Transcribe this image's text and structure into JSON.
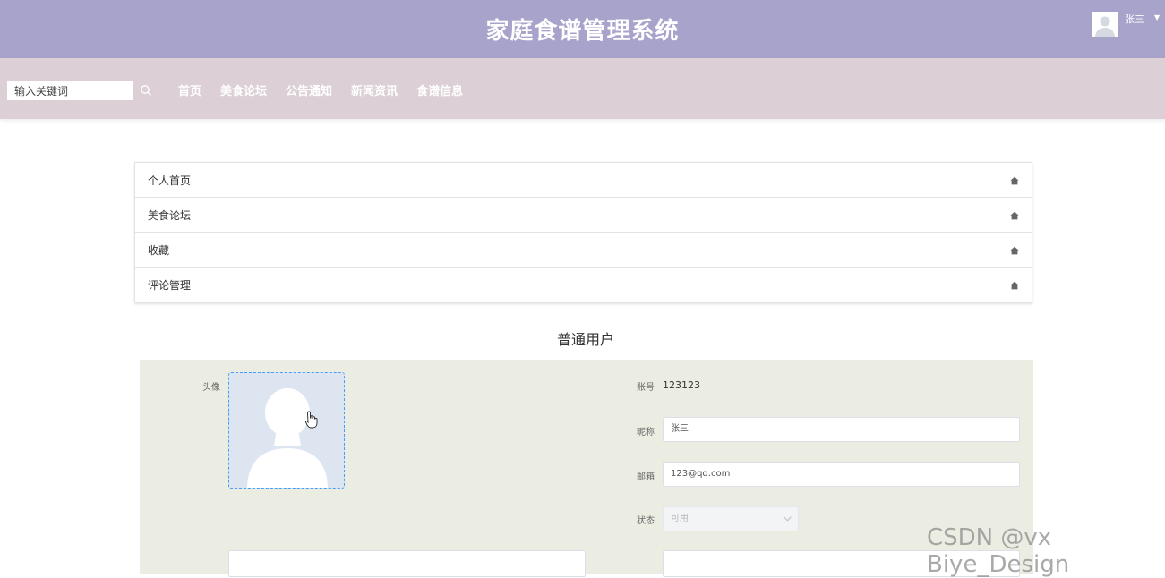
{
  "header": {
    "title": "家庭食谱管理系统",
    "user_name": "张三",
    "caret": "▼",
    "bg_color": "#a8a3cb"
  },
  "navbar": {
    "search_placeholder": "输入关键词",
    "links": [
      "首页",
      "美食论坛",
      "公告通知",
      "新闻资讯",
      "食谱信息"
    ],
    "bg_color": "#dcd0d6"
  },
  "menu": {
    "items": [
      "个人首页",
      "美食论坛",
      "收藏",
      "评论管理"
    ],
    "icon": "home-icon"
  },
  "profile": {
    "section_title": "普通用户",
    "avatar_label": "头像",
    "account_label": "账号",
    "account_value": "123123",
    "nickname_label": "昵称",
    "nickname_value": "张三",
    "email_label": "邮箱",
    "email_value": "123@qq.com",
    "status_label": "状态",
    "status_value": "可用",
    "panel_color": "#ecede2"
  },
  "watermark": "CSDN @vx Biye_Design"
}
